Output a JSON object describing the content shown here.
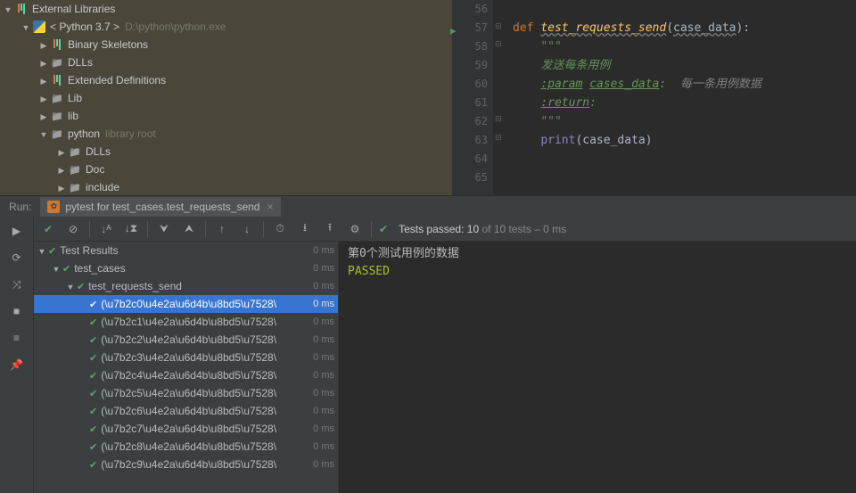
{
  "tree": {
    "ext_lib": "External Libraries",
    "python_ver": "< Python 3.7 >",
    "python_path": "D:\\python\\python.exe",
    "items": [
      "Binary Skeletons",
      "DLLs",
      "Extended Definitions",
      "Lib",
      "lib",
      "python",
      "DLLs",
      "Doc",
      "include"
    ],
    "lib_root": "library root"
  },
  "editor": {
    "lines": {
      "56": "56",
      "57": "57",
      "58": "58",
      "59": "59",
      "60": "60",
      "61": "61",
      "62": "62",
      "63": "63",
      "64": "64",
      "65": "65"
    },
    "code": {
      "def": "def ",
      "fn": "test_requests_send",
      "sig_open": "(",
      "param": "case_data",
      "sig_close": "):",
      "q": "\"\"\"",
      "doc1": "发送每条用例",
      "doc2a": ":param",
      "doc2b": "cases_data",
      "doc2c": ":  每一条用例数据",
      "doc3": ":return",
      "doc3b": ":",
      "print": "print",
      "print_args": "(case_data)"
    }
  },
  "run": {
    "label": "Run:",
    "tab": "pytest for test_cases.test_requests_send",
    "status_pre": "Tests passed: 10",
    "status_post": " of 10 tests – 0 ms"
  },
  "tests": {
    "root": "Test Results",
    "module": "test_cases",
    "func": "test_requests_send",
    "time": "0 ms",
    "cases": [
      "(\\u7b2c0\\u4e2a\\u6d4b\\u8bd5\\u7528\\",
      "(\\u7b2c1\\u4e2a\\u6d4b\\u8bd5\\u7528\\",
      "(\\u7b2c2\\u4e2a\\u6d4b\\u8bd5\\u7528\\",
      "(\\u7b2c3\\u4e2a\\u6d4b\\u8bd5\\u7528\\",
      "(\\u7b2c4\\u4e2a\\u6d4b\\u8bd5\\u7528\\",
      "(\\u7b2c5\\u4e2a\\u6d4b\\u8bd5\\u7528\\",
      "(\\u7b2c6\\u4e2a\\u6d4b\\u8bd5\\u7528\\",
      "(\\u7b2c7\\u4e2a\\u6d4b\\u8bd5\\u7528\\",
      "(\\u7b2c8\\u4e2a\\u6d4b\\u8bd5\\u7528\\",
      "(\\u7b2c9\\u4e2a\\u6d4b\\u8bd5\\u7528\\"
    ]
  },
  "console": {
    "line1": "第0个测试用例的数据",
    "line2": "PASSED"
  }
}
